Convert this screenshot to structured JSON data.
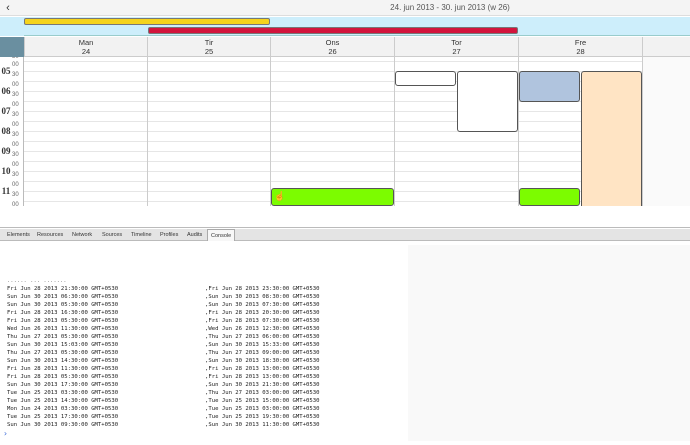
{
  "toolbar": {
    "prev_symbol": "‹",
    "range_title": "24. jun 2013 - 30. jun 2013 (w 26)"
  },
  "allday_events": [
    {
      "name": "yellow",
      "color": "#f5d31c"
    },
    {
      "name": "red",
      "color": "#d2153d"
    }
  ],
  "days": [
    {
      "name": "Man",
      "date": "24"
    },
    {
      "name": "Tir",
      "date": "25"
    },
    {
      "name": "Ons",
      "date": "26"
    },
    {
      "name": "Tor",
      "date": "27"
    },
    {
      "name": "Fre",
      "date": "28"
    }
  ],
  "hours": [
    "05",
    "06",
    "07",
    "08",
    "09",
    "10",
    "11"
  ],
  "minute_labels": [
    "00",
    "30"
  ],
  "events": [
    {
      "color": "#ffffff"
    },
    {
      "color": "#ffffff"
    },
    {
      "color": "#b0c4de"
    },
    {
      "color": "#ffe4c4"
    },
    {
      "color": "#7cfc00"
    },
    {
      "color": "#7cfc00"
    }
  ],
  "devtools_tabs": [
    "Elements",
    "Resources",
    "Network",
    "Sources",
    "Timeline",
    "Profiles",
    "Audits",
    "Console"
  ],
  "devtools_active_tab": "Console",
  "console": {
    "partial_header": "...... ... .......",
    "rows": [
      {
        "start": "Fri Jun 28 2013 21:30:00 GMT+0530",
        "end": ",Fri Jun 28 2013 23:30:00 GMT+0530"
      },
      {
        "start": "Sun Jun 30 2013 06:30:00 GMT+0530",
        "end": ",Sun Jun 30 2013 08:30:00 GMT+0530"
      },
      {
        "start": "Sun Jun 30 2013 05:30:00 GMT+0530",
        "end": ",Sun Jun 30 2013 07:30:00 GMT+0530"
      },
      {
        "start": "Fri Jun 28 2013 16:30:00 GMT+0530",
        "end": ",Fri Jun 28 2013 20:30:00 GMT+0530"
      },
      {
        "start": "Fri Jun 28 2013 05:30:00 GMT+0530",
        "end": ",Fri Jun 28 2013 07:30:00 GMT+0530"
      },
      {
        "start": "Wed Jun 26 2013 11:30:00 GMT+0530",
        "end": ",Wed Jun 26 2013 12:30:00 GMT+0530"
      },
      {
        "start": "Thu Jun 27 2013 05:30:00 GMT+0530",
        "end": ",Thu Jun 27 2013 06:00:00 GMT+0530"
      },
      {
        "start": "Sun Jun 30 2013 15:03:00 GMT+0530",
        "end": ",Sun Jun 30 2013 15:33:00 GMT+0530"
      },
      {
        "start": "Thu Jun 27 2013 05:30:00 GMT+0530",
        "end": ",Thu Jun 27 2013 09:00:00 GMT+0530"
      },
      {
        "start": "Sun Jun 30 2013 14:30:00 GMT+0530",
        "end": ",Sun Jun 30 2013 18:30:00 GMT+0530"
      },
      {
        "start": "Fri Jun 28 2013 11:30:00 GMT+0530",
        "end": ",Fri Jun 28 2013 13:00:00 GMT+0530"
      },
      {
        "start": "Fri Jun 28 2013 05:30:00 GMT+0530",
        "end": ",Fri Jun 28 2013 13:00:00 GMT+0530"
      },
      {
        "start": "Sun Jun 30 2013 17:30:00 GMT+0530",
        "end": ",Sun Jun 30 2013 21:30:00 GMT+0530"
      },
      {
        "start": "Tue Jun 25 2013 03:30:00 GMT+0530",
        "end": ",Thu Jun 27 2013 03:00:00 GMT+0530"
      },
      {
        "start": "Tue Jun 25 2013 14:30:00 GMT+0530",
        "end": ",Tue Jun 25 2013 15:00:00 GMT+0530"
      },
      {
        "start": "Mon Jun 24 2013 03:30:00 GMT+0530",
        "end": ",Tue Jun 25 2013 03:00:00 GMT+0530"
      },
      {
        "start": "Tue Jun 25 2013 17:30:00 GMT+0530",
        "end": ",Tue Jun 25 2013 19:30:00 GMT+0530"
      },
      {
        "start": "Sun Jun 30 2013 09:30:00 GMT+0530",
        "end": ",Sun Jun 30 2013 11:30:00 GMT+0530"
      }
    ],
    "prompt_symbol": "›"
  }
}
